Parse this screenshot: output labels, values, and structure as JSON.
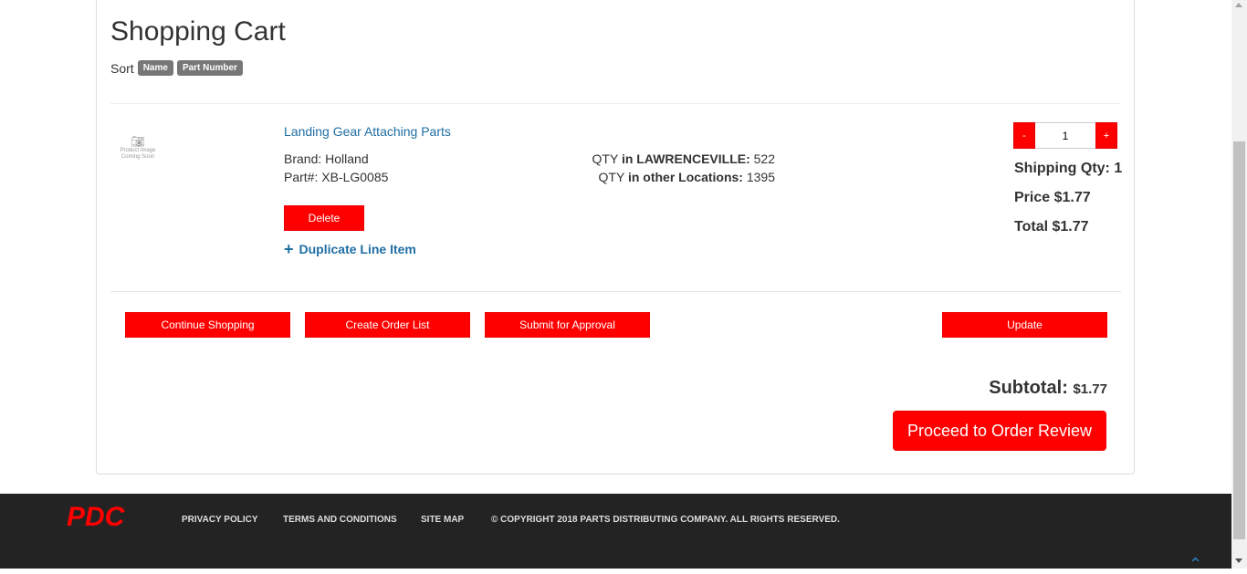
{
  "page": {
    "title": "Shopping Cart"
  },
  "sort": {
    "label": "Sort",
    "options": [
      "Name",
      "Part Number"
    ]
  },
  "item": {
    "image_text": [
      "Product Image",
      "Coming Soon"
    ],
    "name": "Landing Gear Attaching Parts",
    "brand_label": "Brand:",
    "brand": "Holland",
    "part_label": "Part#:",
    "part": "XB-LG0085",
    "qty_local_prefix": "QTY",
    "qty_local_label": "in LAWRENCEVILLE:",
    "qty_local": "522",
    "qty_other_prefix": "QTY",
    "qty_other_label": "in other Locations:",
    "qty_other": "1395",
    "delete_label": "Delete",
    "duplicate_label": "Duplicate Line Item",
    "quantity": "1",
    "minus": "-",
    "plus": "+",
    "shipping_qty": "Shipping Qty: 1",
    "price": "Price $1.77",
    "total": "Total $1.77"
  },
  "actions": {
    "continue": "Continue Shopping",
    "create_list": "Create Order List",
    "submit": "Submit for Approval",
    "update": "Update"
  },
  "summary": {
    "subtotal_label": "Subtotal:",
    "subtotal_value": "$1.77",
    "proceed": "Proceed to Order Review"
  },
  "footer": {
    "logo": "PDC",
    "links": [
      "PRIVACY POLICY",
      "TERMS AND CONDITIONS",
      "SITE MAP"
    ],
    "copyright": "© COPYRIGHT 2018 PARTS DISTRIBUTING COMPANY. ALL RIGHTS RESERVED."
  },
  "colors": {
    "accent": "#ff0000",
    "link": "#1f6ea3",
    "footer_bg": "#232323"
  },
  "icons": [
    "camera-icon",
    "plus-icon",
    "chevron-up-icon"
  ]
}
